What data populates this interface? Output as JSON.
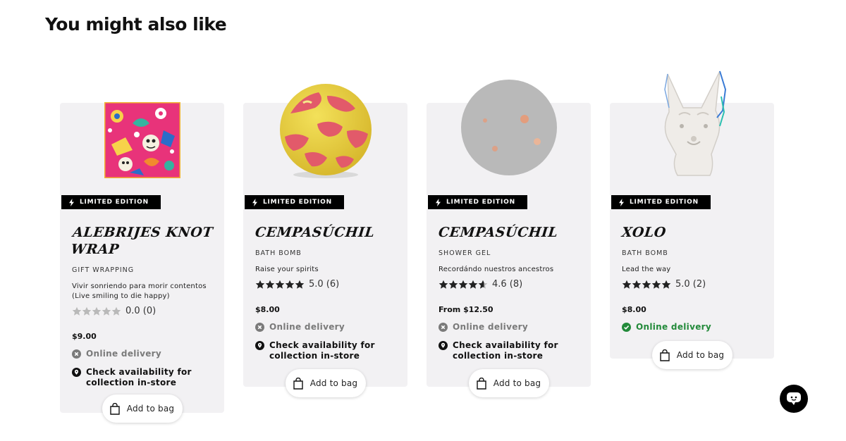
{
  "section": {
    "title": "You might also like"
  },
  "badge_label": "LIMITED EDITION",
  "add_to_bag_label": "Add to bag",
  "online_delivery_label": "Online delivery",
  "collection_label_line1": "Check availability for",
  "collection_label_line2": "collection in-store",
  "colors": {
    "card_bg": "#f2f1f3",
    "green": "#238a3a",
    "muted": "#7a7a7a",
    "badge": "#000000"
  },
  "products": [
    {
      "name_line1": "ALEBRIJES KNOT",
      "name_line2": "WRAP",
      "category": "GIFT WRAPPING",
      "tagline_line1": "Vivir sonriendo para morir contentos",
      "tagline_line2": "(Live smiling to die happy)",
      "rating": 0.0,
      "rating_text": "0.0 (0)",
      "price": "$9.00",
      "online_delivery_available": false,
      "image": "knot-wrap-image"
    },
    {
      "name_line1": "CEMPASÚCHIL",
      "category": "BATH BOMB",
      "tagline_line1": "Raise your spirits",
      "rating": 5.0,
      "rating_text": "5.0 (6)",
      "price": "$8.00",
      "online_delivery_available": false,
      "image": "bath-bomb-image"
    },
    {
      "name_line1": "CEMPASÚCHIL",
      "category": "SHOWER GEL",
      "tagline_line1": "Recordándo nuestros ancestros",
      "rating": 4.6,
      "rating_text": "4.6 (8)",
      "price": "From $12.50",
      "online_delivery_available": false,
      "image": "shower-gel-image"
    },
    {
      "name_line1": "XOLO",
      "category": "BATH BOMB",
      "tagline_line1": "Lead the way",
      "rating": 5.0,
      "rating_text": "5.0 (2)",
      "price": "$8.00",
      "online_delivery_available": true,
      "image": "xolo-bath-bomb-image"
    }
  ]
}
